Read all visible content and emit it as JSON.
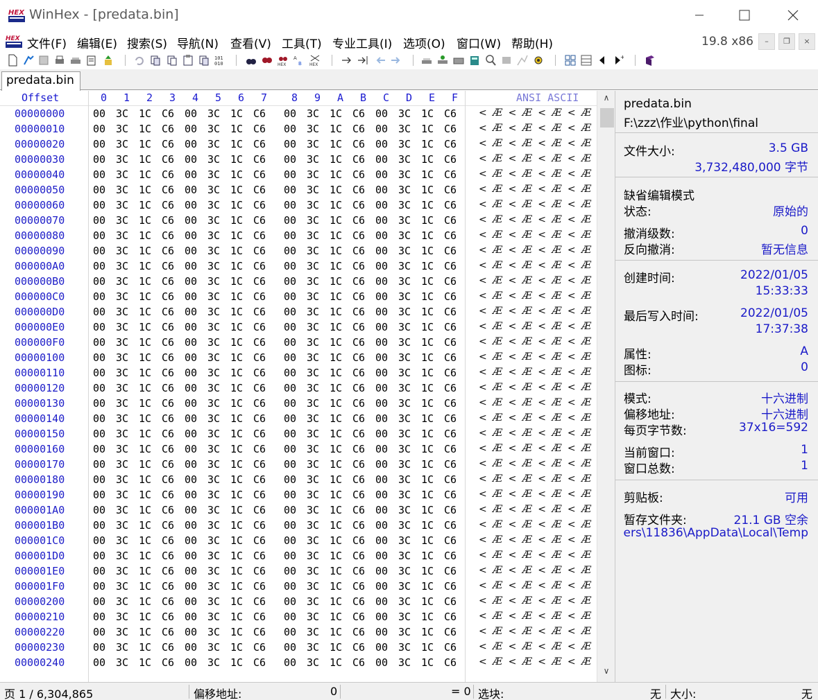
{
  "window": {
    "title": "WinHex - [predata.bin]",
    "version": "19.8 x86"
  },
  "menu": {
    "items": [
      "文件(F)",
      "编辑(E)",
      "搜索(S)",
      "导航(N)",
      "查看(V)",
      "工具(T)",
      "专业工具(I)",
      "选项(O)",
      "窗口(W)",
      "帮助(H)"
    ]
  },
  "tab": {
    "label": "predata.bin"
  },
  "hex": {
    "offset_header": "Offset",
    "columns": [
      "0",
      "1",
      "2",
      "3",
      "4",
      "5",
      "6",
      "7",
      "8",
      "9",
      "A",
      "B",
      "C",
      "D",
      "E",
      "F"
    ],
    "text_header": "ANSI ASCII",
    "rows": [
      {
        "offset": "00000000"
      },
      {
        "offset": "00000010"
      },
      {
        "offset": "00000020"
      },
      {
        "offset": "00000030"
      },
      {
        "offset": "00000040"
      },
      {
        "offset": "00000050"
      },
      {
        "offset": "00000060"
      },
      {
        "offset": "00000070"
      },
      {
        "offset": "00000080"
      },
      {
        "offset": "00000090"
      },
      {
        "offset": "000000A0"
      },
      {
        "offset": "000000B0"
      },
      {
        "offset": "000000C0"
      },
      {
        "offset": "000000D0"
      },
      {
        "offset": "000000E0"
      },
      {
        "offset": "000000F0"
      },
      {
        "offset": "00000100"
      },
      {
        "offset": "00000110"
      },
      {
        "offset": "00000120"
      },
      {
        "offset": "00000130"
      },
      {
        "offset": "00000140"
      },
      {
        "offset": "00000150"
      },
      {
        "offset": "00000160"
      },
      {
        "offset": "00000170"
      },
      {
        "offset": "00000180"
      },
      {
        "offset": "00000190"
      },
      {
        "offset": "000001A0"
      },
      {
        "offset": "000001B0"
      },
      {
        "offset": "000001C0"
      },
      {
        "offset": "000001D0"
      },
      {
        "offset": "000001E0"
      },
      {
        "offset": "000001F0"
      },
      {
        "offset": "00000200"
      },
      {
        "offset": "00000210"
      },
      {
        "offset": "00000220"
      },
      {
        "offset": "00000230"
      },
      {
        "offset": "00000240"
      }
    ],
    "row_bytes": [
      "00",
      "3C",
      "1C",
      "C6",
      "00",
      "3C",
      "1C",
      "C6",
      "00",
      "3C",
      "1C",
      "C6",
      "00",
      "3C",
      "1C",
      "C6"
    ],
    "row_text": "< Æ < Æ < Æ < Æ"
  },
  "info": {
    "filename": "predata.bin",
    "path": "F:\\zzz\\作业\\python\\final",
    "file_size_label": "文件大小:",
    "file_size_value": "3.5 GB",
    "file_size_bytes": "3,732,480,000 字节",
    "default_edit_mode": "缺省编辑模式",
    "state_label": "状态:",
    "state_value": "原始的",
    "undo_level_label": "撤消级数:",
    "undo_level_value": "0",
    "reverse_undo_label": "反向撤消:",
    "reverse_undo_value": "暂无信息",
    "created_label": "创建时间:",
    "created_date": "2022/01/05",
    "created_time": "15:33:33",
    "modified_label": "最后写入时间:",
    "modified_date": "2022/01/05",
    "modified_time": "17:37:38",
    "attr_label": "属性:",
    "attr_value": "A",
    "icon_label": "图标:",
    "icon_value": "0",
    "mode_label": "模式:",
    "mode_value": "十六进制",
    "offset_addr_label": "偏移地址:",
    "offset_addr_value": "十六进制",
    "bytes_per_page_label": "每页字节数:",
    "bytes_per_page_value": "37x16=592",
    "current_window_label": "当前窗口:",
    "current_window_value": "1",
    "total_windows_label": "窗口总数:",
    "total_windows_value": "1",
    "clipboard_label": "剪贴板:",
    "clipboard_value": "可用",
    "temp_folder_label": "暂存文件夹:",
    "temp_folder_free": "21.1 GB 空余",
    "temp_folder_path": "ers\\11836\\AppData\\Local\\Temp"
  },
  "status": {
    "page": "页 1 / 6,304,865",
    "offset_label": "偏移地址:",
    "offset_value": "0",
    "eq_value": "= 0",
    "block_label": "选块:",
    "block_value": "无",
    "size_label": "大小:",
    "size_value": "无"
  },
  "colors": {
    "offset_blue": "#1c1cc8",
    "info_value_blue": "#1a1ac8",
    "panel_bg": "#f0f0f0"
  }
}
